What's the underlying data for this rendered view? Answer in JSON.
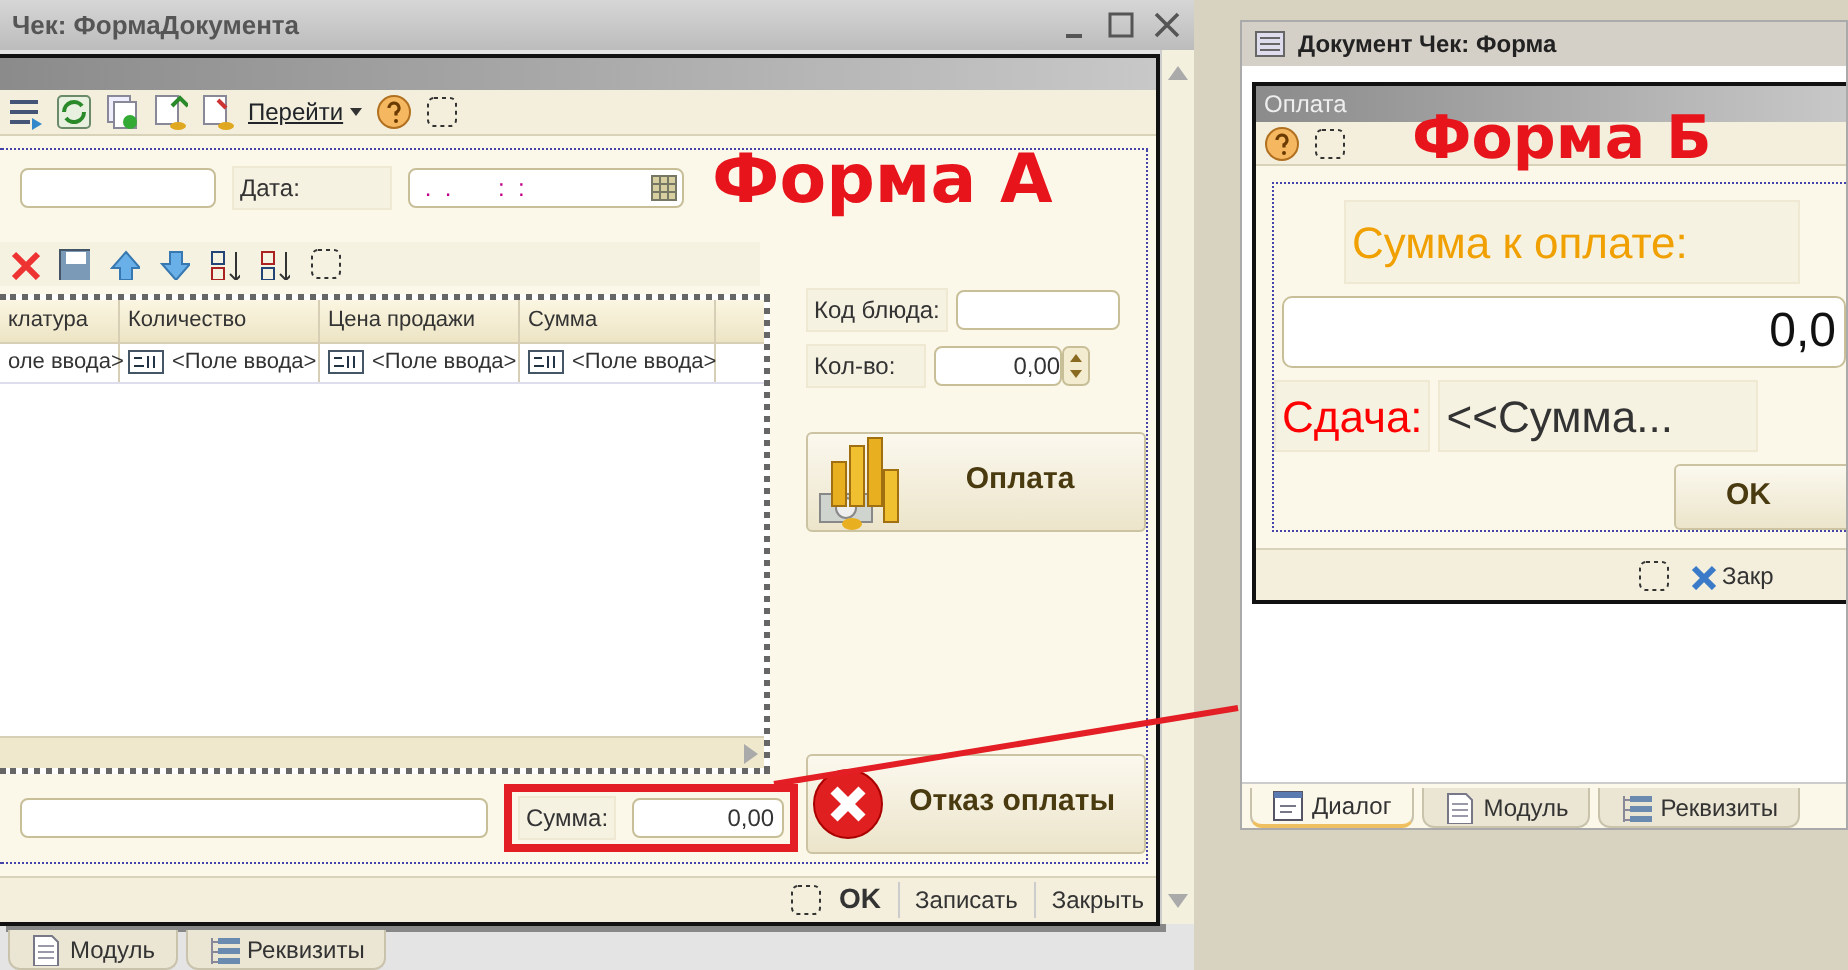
{
  "left_window": {
    "title": "Чек: ФормаДокумента",
    "form": {
      "toolbar_menu": "Перейти",
      "annotation": "Форма А",
      "date_label": "Дата:",
      "date_value": " .  .       :  :",
      "table": {
        "columns": [
          "клатура",
          "Количество",
          "Цена продажи",
          "Сумма"
        ],
        "rows": [
          [
            "оле ввода>",
            "<Поле ввода>",
            "<Поле ввода>",
            "<Поле ввода>"
          ]
        ]
      },
      "code_label": "Код блюда:",
      "qty_label": "Кол-во:",
      "qty_value": "0,00",
      "pay_button": "Оплата",
      "sum_label": "Сумма:",
      "sum_value": "0,00",
      "cancel_button": "Отказ оплаты",
      "footer": [
        "OK",
        "Записать",
        "Закрыть"
      ]
    },
    "tabs": [
      {
        "label": "Модуль",
        "selected": false
      },
      {
        "label": "Реквизиты",
        "selected": false
      }
    ]
  },
  "right_window": {
    "title": "Документ Чек: Форма",
    "dialog": {
      "title": "Оплата",
      "annotation": "Форма Б",
      "amount_label": "Сумма к оплате:",
      "amount_value": "0,0",
      "change_label": "Сдача:",
      "change_value": "<<Сумма...",
      "ok_button": "OK",
      "footer_close": "Закр"
    },
    "tabs": [
      {
        "label": "Диалог",
        "selected": true
      },
      {
        "label": "Модуль",
        "selected": false
      },
      {
        "label": "Реквизиты",
        "selected": false
      }
    ]
  }
}
